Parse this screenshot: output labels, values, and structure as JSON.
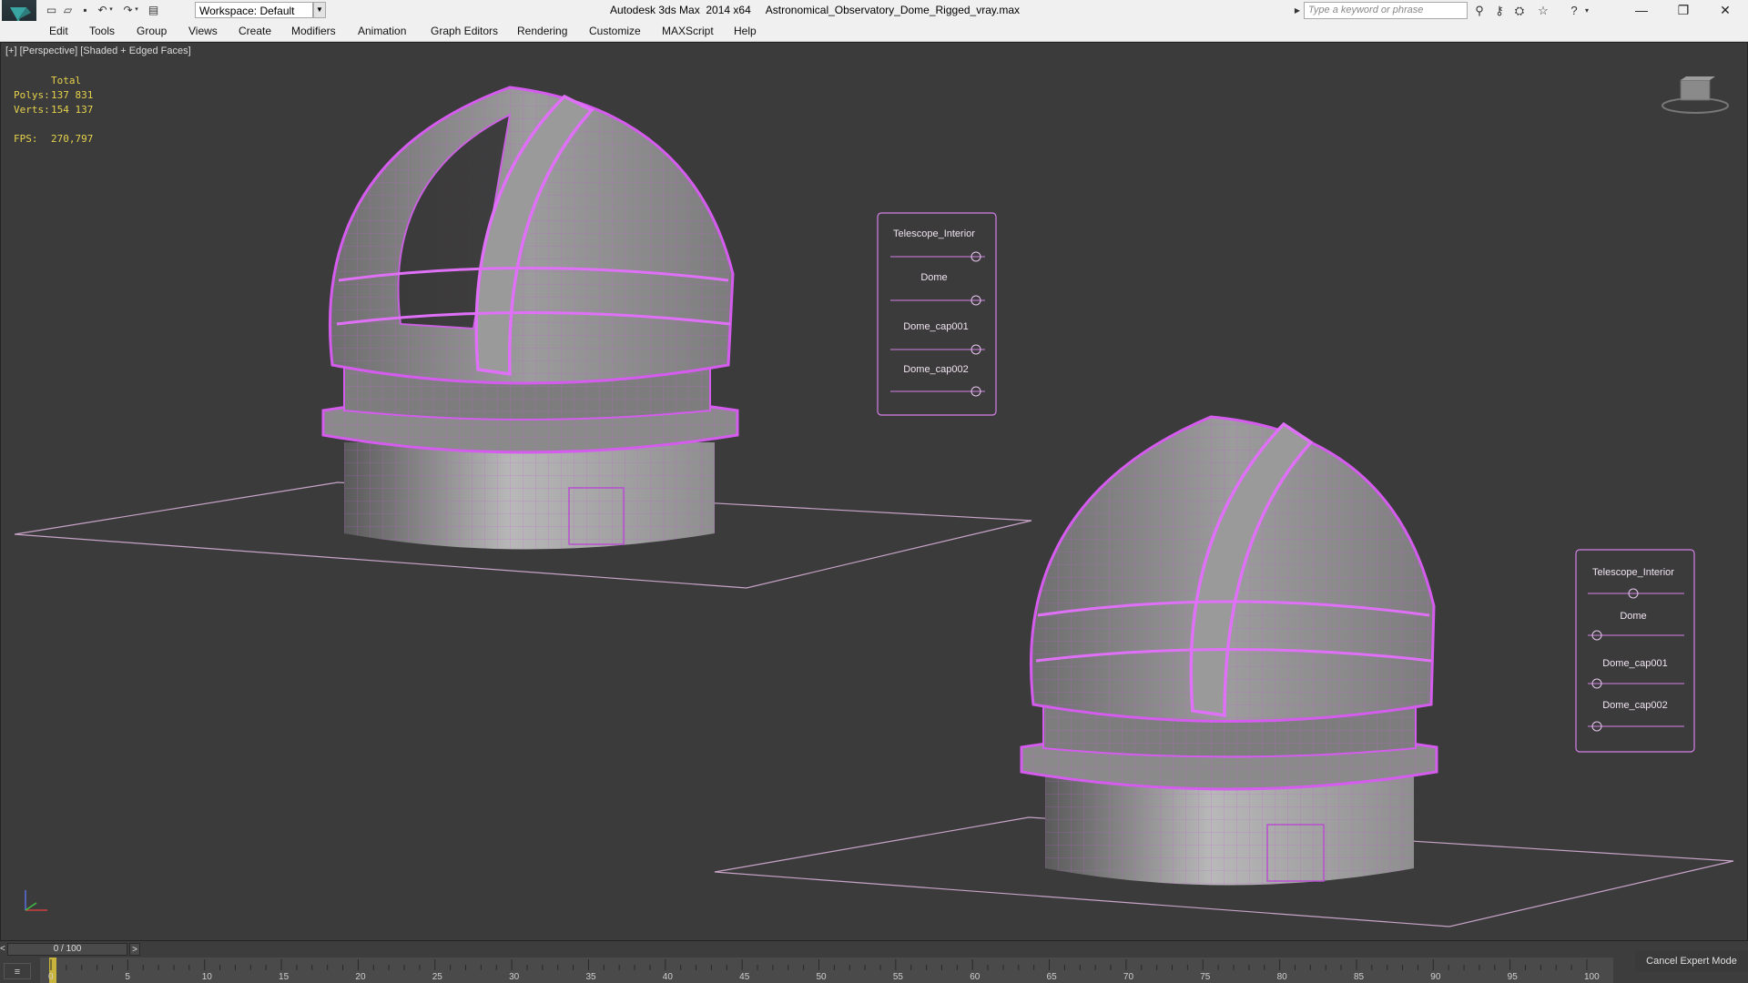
{
  "titlebar": {
    "app_title": "Autodesk 3ds Max  2014 x64     Astronomical_Observatory_Dome_Rigged_vray.max",
    "workspace": "Workspace: Default",
    "search_placeholder": "Type a keyword or phrase"
  },
  "menu": [
    "Edit",
    "Tools",
    "Group",
    "Views",
    "Create",
    "Modifiers",
    "Animation",
    "Graph Editors",
    "Rendering",
    "Customize",
    "MAXScript",
    "Help"
  ],
  "viewport": {
    "label": "[+] [Perspective] [Shaded + Edged Faces]",
    "stats": {
      "total_label": "Total",
      "polys_label": "Polys:",
      "polys_value": "137 831",
      "verts_label": "Verts:",
      "verts_value": "154 137",
      "fps_label": "FPS:",
      "fps_value": "270,797"
    },
    "rig_panels": [
      {
        "labels": [
          "Telescope_Interior",
          "Dome",
          "Dome_cap001",
          "Dome_cap002"
        ]
      },
      {
        "labels": [
          "Telescope_Interior",
          "Dome",
          "Dome_cap001",
          "Dome_cap002"
        ]
      }
    ],
    "wire_color": "#d65cf0"
  },
  "timeline": {
    "frame_display": "0 / 100",
    "prev": "<",
    "next": ">",
    "ticks": [
      "0",
      "5",
      "10",
      "15",
      "20",
      "25",
      "30",
      "35",
      "40",
      "45",
      "50",
      "55",
      "60",
      "65",
      "70",
      "75",
      "80",
      "85",
      "90",
      "95",
      "100"
    ]
  },
  "status": {
    "expert_mode": "Cancel Expert Mode"
  }
}
